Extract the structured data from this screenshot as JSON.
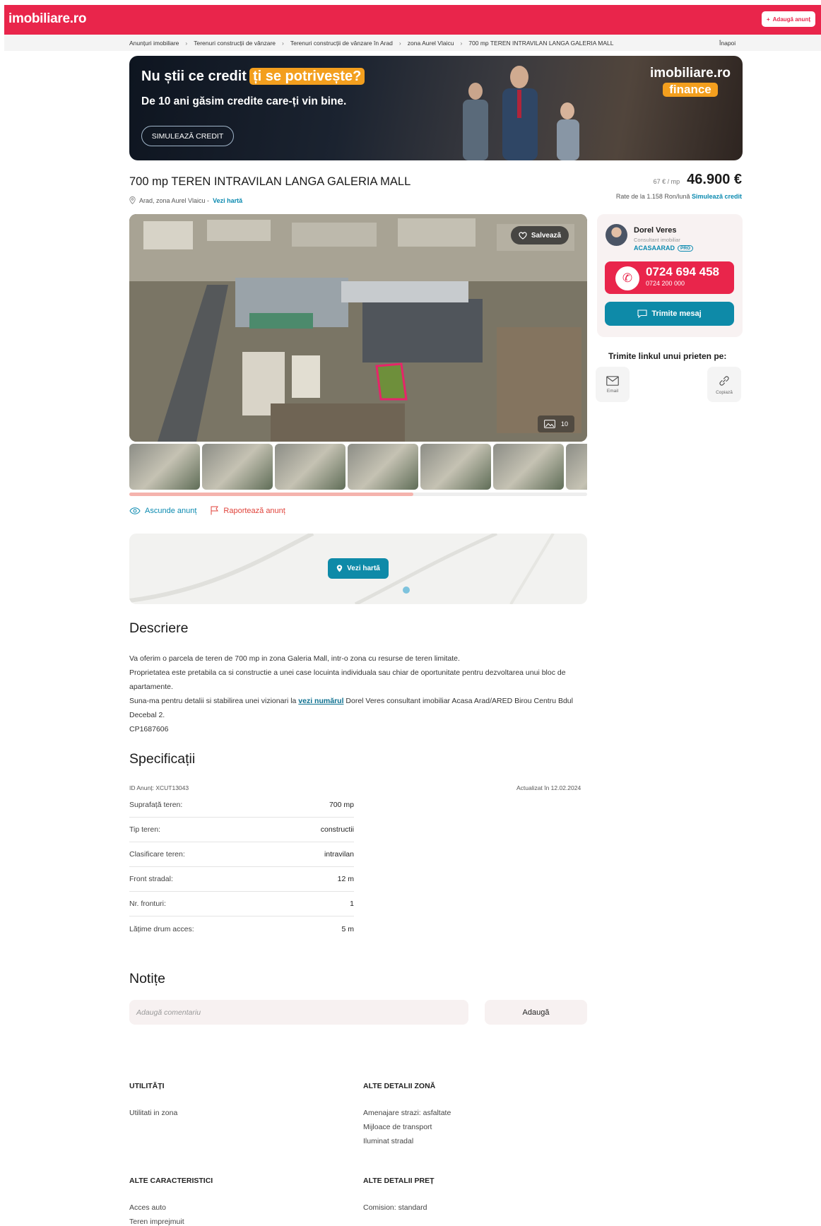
{
  "header": {
    "logo": "imobiliare.ro",
    "add_button": "Adaugă anunț"
  },
  "breadcrumb": {
    "items": [
      "Anunțuri imobiliare",
      "Terenuri construcții de vânzare",
      "Terenuri construcții de vânzare în Arad",
      "zona Aurel Vlaicu",
      "700 mp TEREN INTRAVILAN LANGA GALERIA MALL"
    ],
    "back": "Înapoi"
  },
  "banner": {
    "headline_a": "Nu știi ce credit",
    "headline_b": "ți se potrivește?",
    "subline": "De 10 ani găsim credite care-ți vin bine.",
    "cta": "SIMULEAZĂ CREDIT",
    "brand_top": "imobiliare.ro",
    "brand_bottom": "finance"
  },
  "listing": {
    "title": "700 mp TEREN INTRAVILAN LANGA GALERIA MALL",
    "location": "Arad, zona Aurel Vlaicu -",
    "map_link": "Vezi hartă",
    "price_per_sqm": "67 € / mp",
    "price": "46.900 €",
    "rates_text": "Rate de la 1.158 Ron/lună",
    "rates_link": "Simulează credit"
  },
  "gallery": {
    "save_label": "Salvează",
    "photo_count": "10",
    "scroll_fraction": 0.62
  },
  "actions": {
    "hide": "Ascunde anunț",
    "report": "Raportează anunț"
  },
  "map": {
    "button": "Vezi hartă"
  },
  "description": {
    "heading": "Descriere",
    "line1": "Va oferim o parcela de teren de 700 mp in zona Galeria Mall, intr-o zona cu resurse de teren limitate.",
    "line2": "Proprietatea este pretabila ca si constructie a unei case locuinta individuala sau chiar de oportunitate pentru dezvoltarea unui bloc de apartamente.",
    "line3_a": "Suna-ma pentru detalii si stabilirea unei vizionari la",
    "line3_link": "vezi numărul",
    "line3_b": "Dorel Veres consultant imobiliar Acasa Arad/ARED Birou Centru Bdul Decebal 2.",
    "line4": "CP1687606"
  },
  "specs": {
    "heading": "Specificații",
    "id": "ID Anunț: XCUT13043",
    "updated": "Actualizat în 12.02.2024",
    "rows": [
      {
        "label": "Suprafață teren:",
        "value": "700 mp"
      },
      {
        "label": "Tip teren:",
        "value": "constructii"
      },
      {
        "label": "Clasificare teren:",
        "value": "intravilan"
      },
      {
        "label": "Front stradal:",
        "value": "12 m"
      },
      {
        "label": "Nr. fronturi:",
        "value": "1"
      },
      {
        "label": "Lățime drum acces:",
        "value": "5 m"
      }
    ]
  },
  "notes": {
    "heading": "Notițe",
    "placeholder": "Adaugă comentariu",
    "button": "Adaugă"
  },
  "details": {
    "utilities": {
      "heading": "UTILITĂȚI",
      "items": [
        "Utilitati in zona"
      ]
    },
    "zone": {
      "heading": "ALTE DETALII ZONĂ",
      "items": [
        "Amenajare strazi: asfaltate",
        "Mijloace de transport",
        "Iluminat stradal"
      ]
    },
    "features": {
      "heading": "ALTE CARACTERISTICI",
      "items": [
        "Acces auto",
        "Teren imprejmuit"
      ]
    },
    "price": {
      "heading": "ALTE DETALII PREȚ",
      "items": [
        "Comision: standard"
      ]
    }
  },
  "agent": {
    "name": "Dorel Veres",
    "role": "Consultant imobiliar",
    "agency": "ACASAARAD",
    "badge": "PRO",
    "phone": "0724 694 458",
    "phone_alt": "0724 200 000",
    "message_button": "Trimite mesaj"
  },
  "share": {
    "title": "Trimite linkul unui prieten pe:",
    "email": "Email",
    "copy": "Copiază"
  },
  "colors": {
    "brand": "#e9254b",
    "accent": "#0e8aa8",
    "orange": "#f39f1e"
  }
}
